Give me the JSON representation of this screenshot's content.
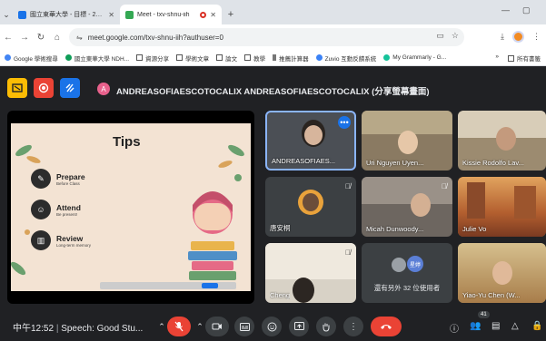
{
  "browser": {
    "tabs": [
      {
        "title": "國立東華大學 - 目標 - 2024年...",
        "active": false
      },
      {
        "title": "Meet - txv-shnu-iih",
        "active": true
      }
    ],
    "url": "meet.google.com/txv-shnu-iih?authuser=0",
    "bookmarks": [
      "Google 學術搜尋",
      "國立東華大學 NDH...",
      "資源分享",
      "學術文章",
      "論文",
      "教學",
      "推薦計算器",
      "Zuvio 互動反饋系統",
      "My Grammarly - G..."
    ],
    "bookmarks_more": "»",
    "all_bookmarks": "所有書籤"
  },
  "meet": {
    "presenter_initial": "A",
    "presenter_label": "ANDREASOFIAESCOTOCALIX ANDREASOFIAESCOTOCALIX (分享螢幕畫面)",
    "slide": {
      "title": "Tips",
      "items": [
        {
          "heading": "Prepare",
          "sub": "Before Class"
        },
        {
          "heading": "Attend",
          "sub": "Be present!"
        },
        {
          "heading": "Review",
          "sub": "Long-term memory"
        }
      ]
    },
    "participants": [
      {
        "name": "ANDREASOFIAES..."
      },
      {
        "name": "Uri Nguyen Uyen..."
      },
      {
        "name": "Kissie Rodolfo Lav..."
      },
      {
        "name": "唐安桐"
      },
      {
        "name": "Micah Dunwoody..."
      },
      {
        "name": "Julie Vo"
      },
      {
        "name": "Cheng"
      },
      {
        "name": "Yiao-Yu Chen (W..."
      }
    ],
    "others_badge": "星婷",
    "others_text": "還有另外 32 位使用者",
    "bottom": {
      "time": "中午12:52",
      "meeting_name": "Speech: Good Stu...",
      "people_count": "41"
    }
  }
}
